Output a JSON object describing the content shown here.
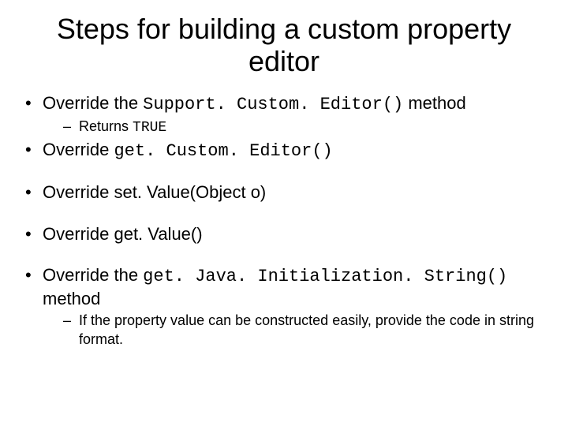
{
  "title": "Steps for building a custom property editor",
  "b1": {
    "pre": "Override the ",
    "code": "Support. Custom. Editor()",
    "post": " method"
  },
  "b1s1": {
    "pre": "Returns ",
    "code": "TRUE"
  },
  "b2": {
    "pre": "Override ",
    "code": "get. Custom. Editor()"
  },
  "b3": {
    "text": "Override set. Value(Object o)"
  },
  "b4": {
    "text": "Override get. Value()"
  },
  "b5": {
    "pre": "Override the ",
    "code": "get. Java. Initialization. String()",
    "post": " method"
  },
  "b5s1": {
    "text": "If the property value can be constructed easily, provide the code in string format."
  }
}
